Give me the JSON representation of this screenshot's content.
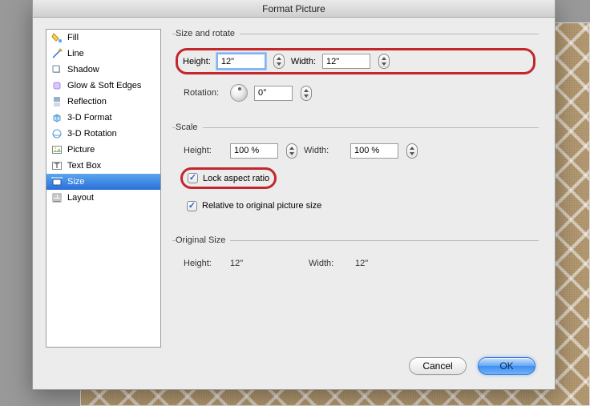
{
  "title": "Format Picture",
  "sidebar": {
    "items": [
      {
        "label": "Fill"
      },
      {
        "label": "Line"
      },
      {
        "label": "Shadow"
      },
      {
        "label": "Glow & Soft Edges"
      },
      {
        "label": "Reflection"
      },
      {
        "label": "3-D Format"
      },
      {
        "label": "3-D Rotation"
      },
      {
        "label": "Picture"
      },
      {
        "label": "Text Box"
      },
      {
        "label": "Size"
      },
      {
        "label": "Layout"
      }
    ]
  },
  "sections": {
    "size_rotate": {
      "legend": "Size and rotate",
      "height_label": "Height:",
      "height_value": "12\"",
      "width_label": "Width:",
      "width_value": "12\"",
      "rotation_label": "Rotation:",
      "rotation_value": "0°"
    },
    "scale": {
      "legend": "Scale",
      "height_label": "Height:",
      "height_value": "100 %",
      "width_label": "Width:",
      "width_value": "100 %",
      "lock_label": "Lock aspect ratio",
      "relative_label": "Relative to original picture size"
    },
    "original": {
      "legend": "Original Size",
      "height_label": "Height:",
      "height_value": "12\"",
      "width_label": "Width:",
      "width_value": "12\""
    }
  },
  "buttons": {
    "cancel": "Cancel",
    "ok": "OK"
  }
}
